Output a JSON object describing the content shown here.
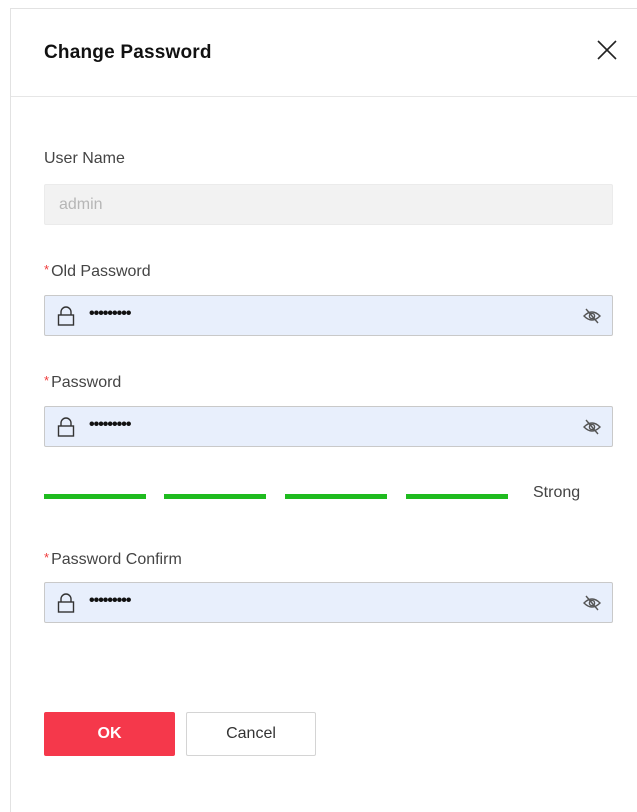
{
  "dialog": {
    "title": "Change Password",
    "close_icon": "close-icon"
  },
  "form": {
    "username": {
      "label": "User Name",
      "value": "admin"
    },
    "old_password": {
      "required_mark": "*",
      "label": "Old Password",
      "masked_value": "•••••••••",
      "lock_icon": "lock-icon",
      "toggle_icon": "eye-hidden-icon"
    },
    "password": {
      "required_mark": "*",
      "label": "Password",
      "masked_value": "•••••••••",
      "lock_icon": "lock-icon",
      "toggle_icon": "eye-hidden-icon"
    },
    "strength": {
      "label": "Strong",
      "level": 4,
      "max_level": 4,
      "color": "#1fbb1f"
    },
    "password_confirm": {
      "required_mark": "*",
      "label": "Password Confirm",
      "masked_value": "•••••••••",
      "lock_icon": "lock-icon",
      "toggle_icon": "eye-hidden-icon"
    }
  },
  "buttons": {
    "ok_label": "OK",
    "cancel_label": "Cancel",
    "ok_color": "#f5384b"
  }
}
